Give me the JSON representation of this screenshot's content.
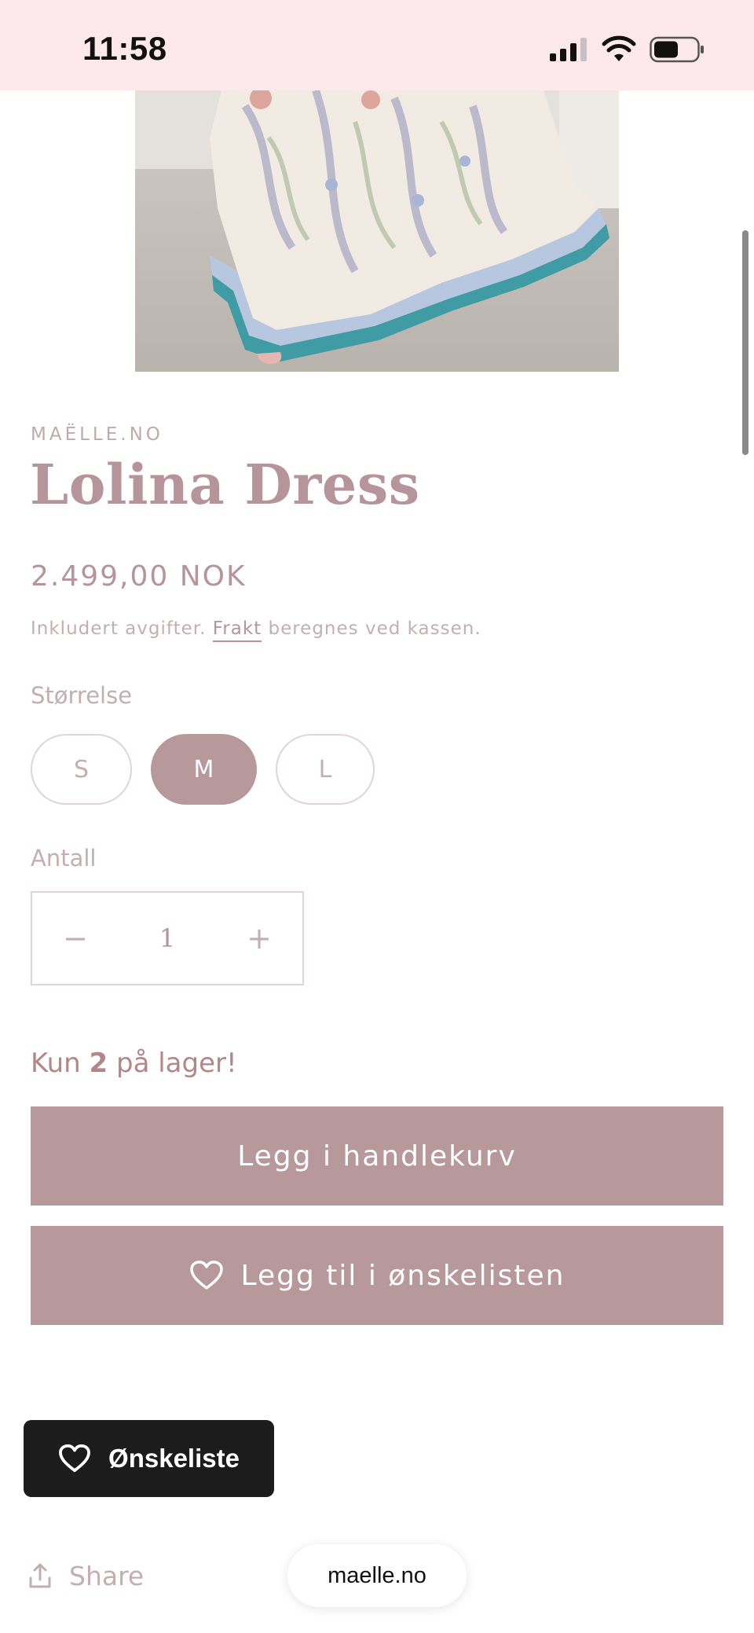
{
  "status_bar": {
    "time": "11:58",
    "icons": [
      "cellular-signal-icon",
      "wifi-icon",
      "battery-icon"
    ]
  },
  "product": {
    "image_icon": "dress-photo",
    "vendor": "MAËLLE.NO",
    "title": "Lolina Dress",
    "price": "2.499,00 NOK",
    "tax_note_before": "Inkludert avgifter.",
    "tax_note_link": "Frakt",
    "tax_note_after": "beregnes ved kassen."
  },
  "size": {
    "label": "Størrelse",
    "options": [
      "S",
      "M",
      "L"
    ],
    "selected": "M"
  },
  "quantity": {
    "label": "Antall",
    "minus": "−",
    "value": "1",
    "plus": "+"
  },
  "stock": {
    "prefix": "Kun",
    "count": "2",
    "suffix": "på lager!"
  },
  "actions": {
    "add_to_cart": "Legg i handlekurv",
    "add_to_wishlist": "Legg til i ønskelisten"
  },
  "floating_wishlist": {
    "label": "Ønskeliste"
  },
  "share": {
    "label": "Share"
  },
  "browser": {
    "url": "maelle.no"
  },
  "colors": {
    "accent": "#b8999b",
    "status_bar_bg": "#fde8ec",
    "dark_button": "#1c1c1c"
  }
}
